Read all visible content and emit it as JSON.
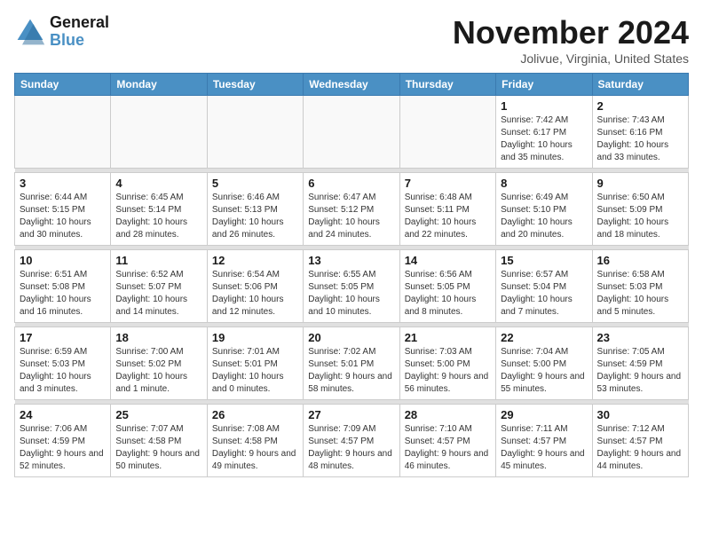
{
  "header": {
    "logo_line1": "General",
    "logo_line2": "Blue",
    "month_title": "November 2024",
    "location": "Jolivue, Virginia, United States"
  },
  "weekdays": [
    "Sunday",
    "Monday",
    "Tuesday",
    "Wednesday",
    "Thursday",
    "Friday",
    "Saturday"
  ],
  "weeks": [
    [
      {
        "day": "",
        "info": ""
      },
      {
        "day": "",
        "info": ""
      },
      {
        "day": "",
        "info": ""
      },
      {
        "day": "",
        "info": ""
      },
      {
        "day": "",
        "info": ""
      },
      {
        "day": "1",
        "info": "Sunrise: 7:42 AM\nSunset: 6:17 PM\nDaylight: 10 hours and 35 minutes."
      },
      {
        "day": "2",
        "info": "Sunrise: 7:43 AM\nSunset: 6:16 PM\nDaylight: 10 hours and 33 minutes."
      }
    ],
    [
      {
        "day": "3",
        "info": "Sunrise: 6:44 AM\nSunset: 5:15 PM\nDaylight: 10 hours and 30 minutes."
      },
      {
        "day": "4",
        "info": "Sunrise: 6:45 AM\nSunset: 5:14 PM\nDaylight: 10 hours and 28 minutes."
      },
      {
        "day": "5",
        "info": "Sunrise: 6:46 AM\nSunset: 5:13 PM\nDaylight: 10 hours and 26 minutes."
      },
      {
        "day": "6",
        "info": "Sunrise: 6:47 AM\nSunset: 5:12 PM\nDaylight: 10 hours and 24 minutes."
      },
      {
        "day": "7",
        "info": "Sunrise: 6:48 AM\nSunset: 5:11 PM\nDaylight: 10 hours and 22 minutes."
      },
      {
        "day": "8",
        "info": "Sunrise: 6:49 AM\nSunset: 5:10 PM\nDaylight: 10 hours and 20 minutes."
      },
      {
        "day": "9",
        "info": "Sunrise: 6:50 AM\nSunset: 5:09 PM\nDaylight: 10 hours and 18 minutes."
      }
    ],
    [
      {
        "day": "10",
        "info": "Sunrise: 6:51 AM\nSunset: 5:08 PM\nDaylight: 10 hours and 16 minutes."
      },
      {
        "day": "11",
        "info": "Sunrise: 6:52 AM\nSunset: 5:07 PM\nDaylight: 10 hours and 14 minutes."
      },
      {
        "day": "12",
        "info": "Sunrise: 6:54 AM\nSunset: 5:06 PM\nDaylight: 10 hours and 12 minutes."
      },
      {
        "day": "13",
        "info": "Sunrise: 6:55 AM\nSunset: 5:05 PM\nDaylight: 10 hours and 10 minutes."
      },
      {
        "day": "14",
        "info": "Sunrise: 6:56 AM\nSunset: 5:05 PM\nDaylight: 10 hours and 8 minutes."
      },
      {
        "day": "15",
        "info": "Sunrise: 6:57 AM\nSunset: 5:04 PM\nDaylight: 10 hours and 7 minutes."
      },
      {
        "day": "16",
        "info": "Sunrise: 6:58 AM\nSunset: 5:03 PM\nDaylight: 10 hours and 5 minutes."
      }
    ],
    [
      {
        "day": "17",
        "info": "Sunrise: 6:59 AM\nSunset: 5:03 PM\nDaylight: 10 hours and 3 minutes."
      },
      {
        "day": "18",
        "info": "Sunrise: 7:00 AM\nSunset: 5:02 PM\nDaylight: 10 hours and 1 minute."
      },
      {
        "day": "19",
        "info": "Sunrise: 7:01 AM\nSunset: 5:01 PM\nDaylight: 10 hours and 0 minutes."
      },
      {
        "day": "20",
        "info": "Sunrise: 7:02 AM\nSunset: 5:01 PM\nDaylight: 9 hours and 58 minutes."
      },
      {
        "day": "21",
        "info": "Sunrise: 7:03 AM\nSunset: 5:00 PM\nDaylight: 9 hours and 56 minutes."
      },
      {
        "day": "22",
        "info": "Sunrise: 7:04 AM\nSunset: 5:00 PM\nDaylight: 9 hours and 55 minutes."
      },
      {
        "day": "23",
        "info": "Sunrise: 7:05 AM\nSunset: 4:59 PM\nDaylight: 9 hours and 53 minutes."
      }
    ],
    [
      {
        "day": "24",
        "info": "Sunrise: 7:06 AM\nSunset: 4:59 PM\nDaylight: 9 hours and 52 minutes."
      },
      {
        "day": "25",
        "info": "Sunrise: 7:07 AM\nSunset: 4:58 PM\nDaylight: 9 hours and 50 minutes."
      },
      {
        "day": "26",
        "info": "Sunrise: 7:08 AM\nSunset: 4:58 PM\nDaylight: 9 hours and 49 minutes."
      },
      {
        "day": "27",
        "info": "Sunrise: 7:09 AM\nSunset: 4:57 PM\nDaylight: 9 hours and 48 minutes."
      },
      {
        "day": "28",
        "info": "Sunrise: 7:10 AM\nSunset: 4:57 PM\nDaylight: 9 hours and 46 minutes."
      },
      {
        "day": "29",
        "info": "Sunrise: 7:11 AM\nSunset: 4:57 PM\nDaylight: 9 hours and 45 minutes."
      },
      {
        "day": "30",
        "info": "Sunrise: 7:12 AM\nSunset: 4:57 PM\nDaylight: 9 hours and 44 minutes."
      }
    ]
  ]
}
